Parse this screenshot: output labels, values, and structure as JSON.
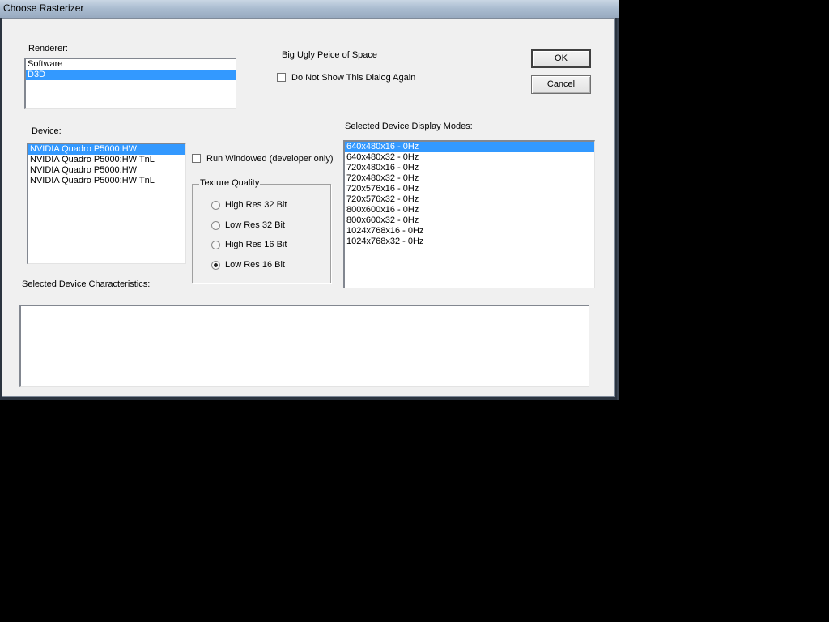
{
  "window": {
    "title": "Choose Rasterizer"
  },
  "renderer": {
    "label": "Renderer:",
    "items": [
      {
        "label": "Software",
        "selected": false
      },
      {
        "label": "D3D",
        "selected": true
      }
    ]
  },
  "spacer_text": "Big Ugly Peice of Space",
  "dont_show": {
    "label": "Do Not Show This Dialog Again",
    "checked": false
  },
  "buttons": {
    "ok": "OK",
    "cancel": "Cancel"
  },
  "device": {
    "label": "Device:",
    "items": [
      {
        "label": "NVIDIA Quadro P5000:HW",
        "selected": true
      },
      {
        "label": "NVIDIA Quadro P5000:HW TnL",
        "selected": false
      },
      {
        "label": "NVIDIA Quadro P5000:HW",
        "selected": false
      },
      {
        "label": "NVIDIA Quadro P5000:HW TnL",
        "selected": false
      }
    ]
  },
  "run_windowed": {
    "label": "Run Windowed (developer only)",
    "checked": false
  },
  "texture_quality": {
    "title": "Texture Quality",
    "options": [
      {
        "label": "High Res 32 Bit",
        "checked": false
      },
      {
        "label": "Low Res 32 Bit",
        "checked": false
      },
      {
        "label": "High Res 16 Bit",
        "checked": false
      },
      {
        "label": "Low Res 16 Bit",
        "checked": true
      }
    ]
  },
  "display_modes": {
    "label": "Selected Device Display Modes:",
    "items": [
      {
        "label": "640x480x16 - 0Hz",
        "selected": true
      },
      {
        "label": "640x480x32 - 0Hz",
        "selected": false
      },
      {
        "label": "720x480x16 - 0Hz",
        "selected": false
      },
      {
        "label": "720x480x32 - 0Hz",
        "selected": false
      },
      {
        "label": "720x576x16 - 0Hz",
        "selected": false
      },
      {
        "label": "720x576x32 - 0Hz",
        "selected": false
      },
      {
        "label": "800x600x16 - 0Hz",
        "selected": false
      },
      {
        "label": "800x600x32 - 0Hz",
        "selected": false
      },
      {
        "label": "1024x768x16 - 0Hz",
        "selected": false
      },
      {
        "label": "1024x768x32 - 0Hz",
        "selected": false
      }
    ]
  },
  "characteristics": {
    "label": "Selected Device Characteristics:"
  }
}
